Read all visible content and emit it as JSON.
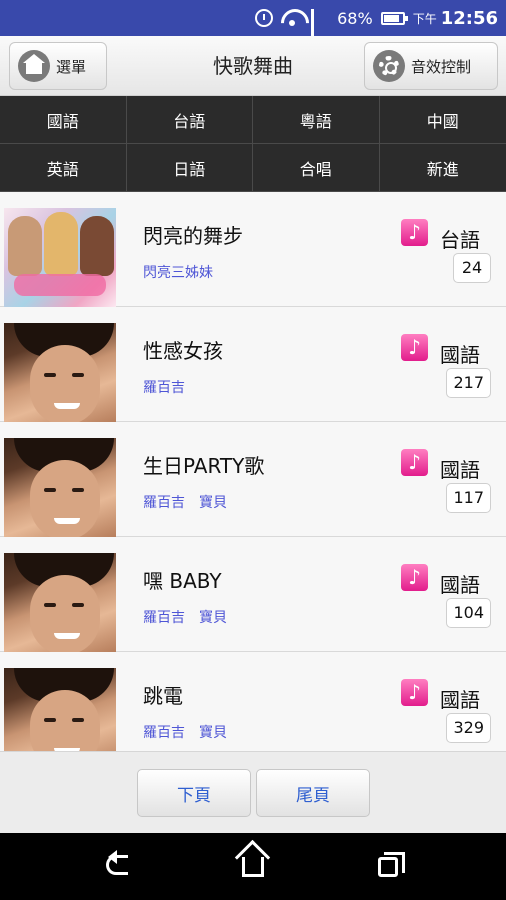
{
  "status_bar": {
    "battery_percent": "68%",
    "time_ampm": "下午",
    "time": "12:56",
    "icons": [
      "alarm-icon",
      "wifi-icon",
      "signal-icon",
      "battery-icon"
    ]
  },
  "header": {
    "menu_label": "選單",
    "title": "快歌舞曲",
    "fx_label": "音效控制"
  },
  "categories": [
    "國語",
    "台語",
    "粵語",
    "中國",
    "英語",
    "日語",
    "合唱",
    "新進"
  ],
  "songs": [
    {
      "title": "閃亮的舞步",
      "artists": [
        "閃亮三姊妹"
      ],
      "language": "台語",
      "number": "24",
      "thumbnail": "girl-group-cover"
    },
    {
      "title": "性感女孩",
      "artists": [
        "羅百吉"
      ],
      "language": "國語",
      "number": "217",
      "thumbnail": "male-singer-portrait"
    },
    {
      "title": "生日PARTY歌",
      "artists": [
        "羅百吉",
        "寶貝"
      ],
      "language": "國語",
      "number": "117",
      "thumbnail": "male-singer-portrait"
    },
    {
      "title": "嘿 BABY",
      "artists": [
        "羅百吉",
        "寶貝"
      ],
      "language": "國語",
      "number": "104",
      "thumbnail": "male-singer-portrait"
    },
    {
      "title": "跳電",
      "artists": [
        "羅百吉",
        "寶貝"
      ],
      "language": "國語",
      "number": "329",
      "thumbnail": "male-singer-portrait"
    }
  ],
  "pager": {
    "next_label": "下頁",
    "last_label": "尾頁"
  },
  "colors": {
    "status_bar": "#3949ab",
    "category_bg": "#2b2b2b",
    "artist_link": "#4f56d6",
    "note_icon": "#e21d8c",
    "pager_text": "#2f5fd0"
  }
}
